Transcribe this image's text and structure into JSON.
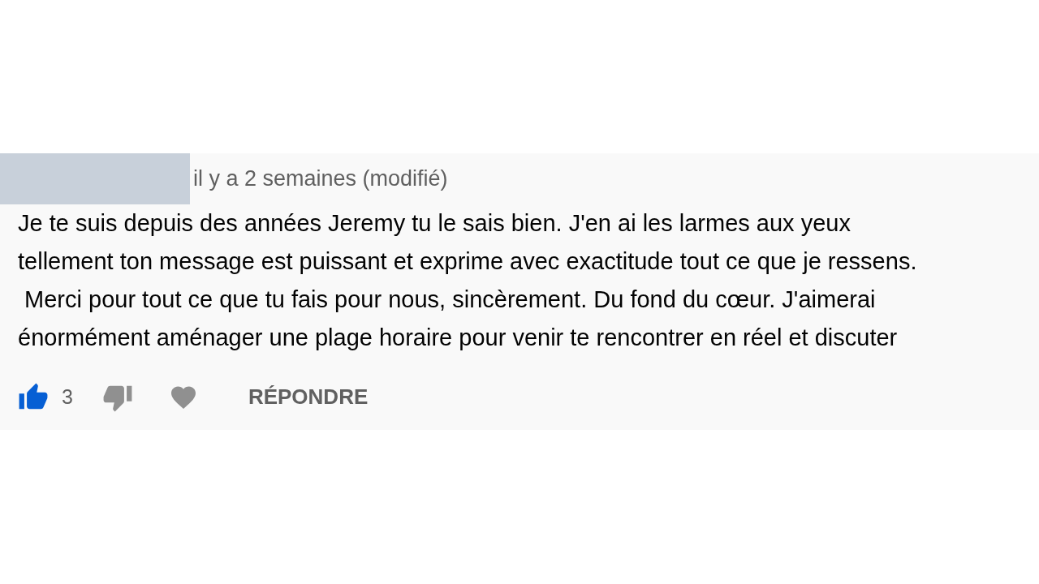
{
  "comment": {
    "timestamp": "il y a 2 semaines (modifié)",
    "body_lines": [
      "Je te suis depuis des années Jeremy tu le sais bien. J'en ai les larmes aux yeux",
      "tellement ton message est puissant et exprime avec exactitude tout ce que je ressens.",
      " Merci pour tout ce que tu fais pour nous, sincèrement. Du fond du cœur. J'aimerai",
      "énormément aménager une plage horaire pour venir te rencontrer en réel et discuter"
    ],
    "like_count": "3",
    "liked": true,
    "disliked": false,
    "hearted": false,
    "reply_label": "RÉPONDRE"
  }
}
